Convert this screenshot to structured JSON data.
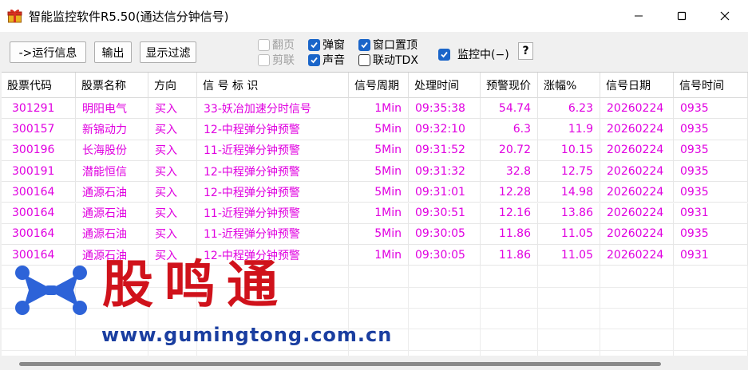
{
  "window": {
    "title": "智能监控软件R5.50(通达信分钟信号)"
  },
  "toolbar": {
    "run_info_label": "->运行信息",
    "export_label": "输出",
    "filter_label": "显示过滤",
    "page_turn_label": "翻页",
    "clip_link_label": "剪联",
    "popup_label": "弹窗",
    "sound_label": "声音",
    "topmost_label": "窗口置顶",
    "link_tdx_label": "联动TDX",
    "monitoring_label": "监控中(−)",
    "help_label": "?"
  },
  "checkboxes": {
    "page_turn": false,
    "clip_link": false,
    "popup": true,
    "sound": true,
    "topmost": true,
    "link_tdx": false,
    "monitoring": true
  },
  "table": {
    "columns": [
      "股票代码",
      "股票名称",
      "方向",
      "信 号 标 识",
      "信号周期",
      "处理时间",
      "预警现价",
      "涨幅%",
      "信号日期",
      "信号时间"
    ],
    "rows": [
      [
        "301291",
        "明阳电气",
        "买入",
        "33-妖冶加速分时信号",
        "1Min",
        "09:35:38",
        "54.74",
        "6.23",
        "20260224",
        "0935"
      ],
      [
        "300157",
        "新锦动力",
        "买入",
        "12-中程弹分钟预警",
        "5Min",
        "09:32:10",
        "6.3",
        "11.9",
        "20260224",
        "0935"
      ],
      [
        "300196",
        "长海股份",
        "买入",
        "11-近程弹分钟预警",
        "5Min",
        "09:31:52",
        "20.72",
        "10.15",
        "20260224",
        "0935"
      ],
      [
        "300191",
        "潜能恒信",
        "买入",
        "12-中程弹分钟预警",
        "5Min",
        "09:31:32",
        "32.8",
        "12.75",
        "20260224",
        "0935"
      ],
      [
        "300164",
        "通源石油",
        "买入",
        "12-中程弹分钟预警",
        "5Min",
        "09:31:01",
        "12.28",
        "14.98",
        "20260224",
        "0935"
      ],
      [
        "300164",
        "通源石油",
        "买入",
        "11-近程弹分钟预警",
        "1Min",
        "09:30:51",
        "12.16",
        "13.86",
        "20260224",
        "0931"
      ],
      [
        "300164",
        "通源石油",
        "买入",
        "11-近程弹分钟预警",
        "5Min",
        "09:30:05",
        "11.86",
        "11.05",
        "20260224",
        "0935"
      ],
      [
        "300164",
        "通源石油",
        "买入",
        "12-中程弹分钟预警",
        "1Min",
        "09:30:05",
        "11.86",
        "11.05",
        "20260224",
        "0931"
      ]
    ]
  },
  "watermark": {
    "brand": "股鸣通",
    "url": "www.gumingtong.com.cn"
  },
  "colors": {
    "row_text": "#e000e0",
    "brand_red": "#d0121b",
    "brand_blue": "#1a3ea0",
    "checkbox_on": "#1a65c9"
  },
  "icons": {
    "app": "gift-box-icon",
    "minimize": "minimize-icon",
    "maximize": "maximize-icon",
    "close": "close-icon",
    "check": "check-icon"
  }
}
